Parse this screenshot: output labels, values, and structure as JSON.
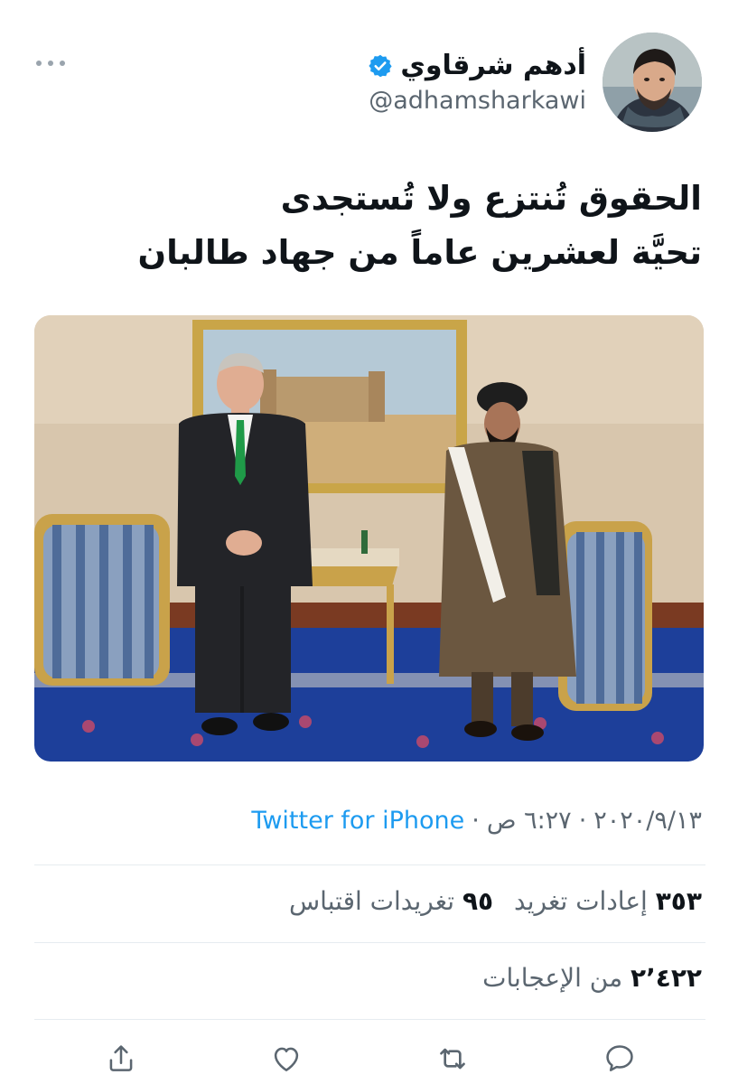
{
  "author": {
    "display_name": "أدهم شرقاوي",
    "handle": "@adhamsharkawi",
    "verified": true
  },
  "tweet": {
    "lines": [
      "الحقوق تُنتزع ولا تُستجدى",
      "تحيَّة لعشرين عاماً من جهاد طالبان"
    ]
  },
  "meta": {
    "date": "٢٠٢٠/٩/١٣",
    "time": "٦:٢٧ ص",
    "separator": "·",
    "source": "Twitter for iPhone"
  },
  "stats": {
    "retweets_count": "٣٥٣",
    "retweets_label": "إعادات تغريد",
    "quotes_count": "٩٥",
    "quotes_label": "تغريدات اقتباس",
    "likes_count": "٢٬٤٢٢",
    "likes_label": "من الإعجابات"
  },
  "actions": [
    "reply-icon",
    "retweet-icon",
    "like-icon",
    "share-icon"
  ],
  "colors": {
    "link": "#1d9bf0",
    "secondary_text": "#5b6670",
    "divider": "#e6ecf0",
    "icon": "#5b6670"
  }
}
